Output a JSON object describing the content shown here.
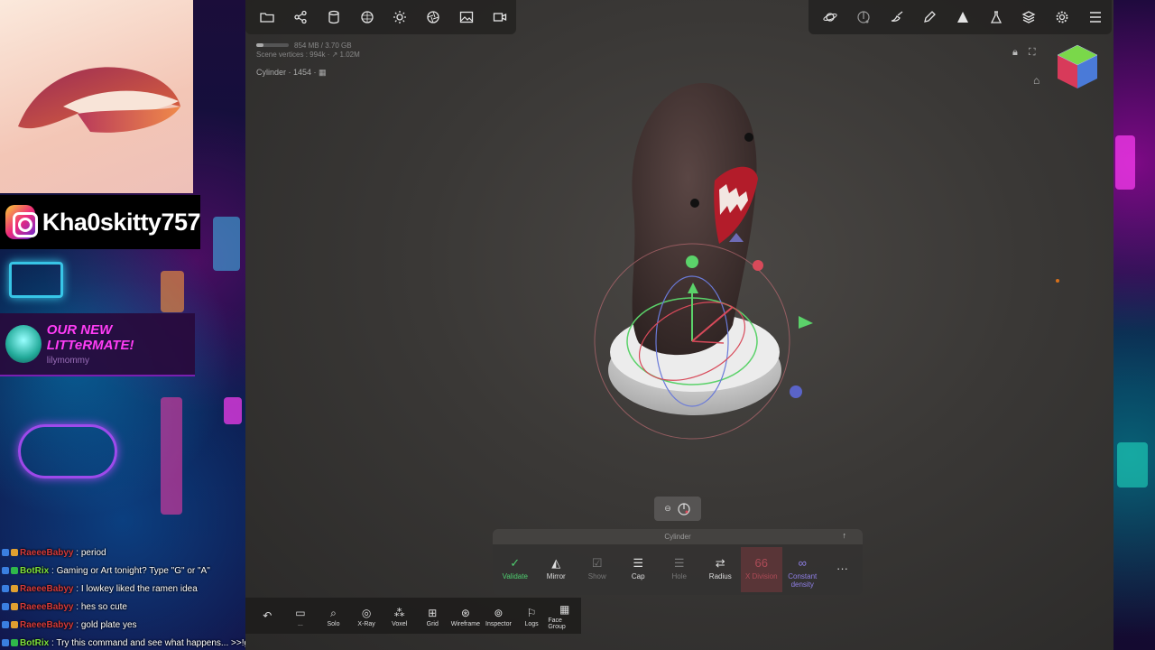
{
  "overlay": {
    "instagram_handle": "Kha0skitty757",
    "sub_alert_title": "OUR NEW LITTeRMATE!",
    "sub_alert_name": "lilymommy",
    "chat": [
      {
        "user": "RaeeeBabyy",
        "msg": ": period",
        "color": "#d43a3a"
      },
      {
        "user": "BotRix",
        "msg": ": Gaming or Art tonight? Type \"G\" or \"A\"",
        "color": "#7ee03a"
      },
      {
        "user": "RaeeeBabyy",
        "msg": ": I lowkey liked the ramen idea",
        "color": "#d43a3a"
      },
      {
        "user": "RaeeeBabyy",
        "msg": ": hes so cute",
        "color": "#d43a3a"
      },
      {
        "user": "RaeeeBabyy",
        "msg": ": gold plate yes",
        "color": "#d43a3a"
      },
      {
        "user": "BotRix",
        "msg": ": Try this command and see what happens... >>!get",
        "color": "#7ee03a"
      }
    ]
  },
  "app": {
    "top_left_tools": [
      "folder-icon",
      "share-icon",
      "cylinder-icon",
      "sphere-icon",
      "sun-icon",
      "aperture-icon",
      "image-icon",
      "camera-icon"
    ],
    "top_right_tools": [
      "planet-icon",
      "gizmo-icon",
      "brush-icon",
      "pen-icon",
      "triangle-icon",
      "flask-icon",
      "layers-icon",
      "gear-icon",
      "menu-icon"
    ],
    "memory_text": "854 MB / 3.70 GB",
    "scene_vertices_text": "Scene vertices : 994k · ↗ 1.02M",
    "memory_fraction": 0.23,
    "object_label": "Cylinder · 1454 · ▦",
    "tool_panel": {
      "title": "Cylinder",
      "items": [
        {
          "label": "Validate",
          "icon": "✓",
          "style": "green"
        },
        {
          "label": "Mirror",
          "icon": "◭",
          "style": ""
        },
        {
          "label": "Show",
          "icon": "☑",
          "style": "dim"
        },
        {
          "label": "Cap",
          "icon": "☰",
          "style": ""
        },
        {
          "label": "Hole",
          "icon": "☰",
          "style": "dim"
        },
        {
          "label": "Radius",
          "icon": "⇄",
          "style": ""
        },
        {
          "label": "X Division",
          "icon": "66",
          "style": "red"
        },
        {
          "label": "Constant density",
          "icon": "∞",
          "style": "purple"
        }
      ],
      "more": "···"
    },
    "bottom_tools": [
      {
        "label": "",
        "icon": "↶"
      },
      {
        "label": "...",
        "icon": "▭"
      },
      {
        "label": "Solo",
        "icon": "⌕"
      },
      {
        "label": "X-Ray",
        "icon": "◎"
      },
      {
        "label": "Voxel",
        "icon": "⁂"
      },
      {
        "label": "Grid",
        "icon": "⊞"
      },
      {
        "label": "Wireframe",
        "icon": "⊛"
      },
      {
        "label": "Inspector",
        "icon": "⊚"
      },
      {
        "label": "Logs",
        "icon": "⚐"
      },
      {
        "label": "Face Group",
        "icon": "▦"
      }
    ]
  }
}
